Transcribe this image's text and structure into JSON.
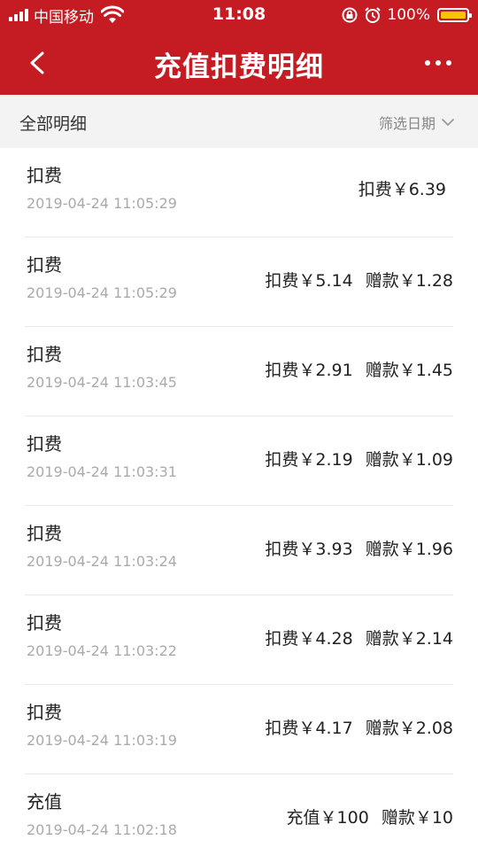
{
  "status_bar": {
    "carrier": "中国移动",
    "time": "11:08",
    "battery": "100%"
  },
  "nav": {
    "title": "充值扣费明细"
  },
  "filter": {
    "label": "全部明细",
    "date_filter": "筛选日期"
  },
  "records": [
    {
      "type": "扣费",
      "date": "2019-04-24 11:05:29",
      "amount": "扣费￥6.39",
      "bonus": ""
    },
    {
      "type": "扣费",
      "date": "2019-04-24 11:05:29",
      "amount": "扣费￥5.14",
      "bonus": "赠款￥1.28"
    },
    {
      "type": "扣费",
      "date": "2019-04-24 11:03:45",
      "amount": "扣费￥2.91",
      "bonus": "赠款￥1.45"
    },
    {
      "type": "扣费",
      "date": "2019-04-24 11:03:31",
      "amount": "扣费￥2.19",
      "bonus": "赠款￥1.09"
    },
    {
      "type": "扣费",
      "date": "2019-04-24 11:03:24",
      "amount": "扣费￥3.93",
      "bonus": "赠款￥1.96"
    },
    {
      "type": "扣费",
      "date": "2019-04-24 11:03:22",
      "amount": "扣费￥4.28",
      "bonus": "赠款￥2.14"
    },
    {
      "type": "扣费",
      "date": "2019-04-24 11:03:19",
      "amount": "扣费￥4.17",
      "bonus": "赠款￥2.08"
    },
    {
      "type": "充值",
      "date": "2019-04-24 11:02:18",
      "amount": "充值￥100",
      "bonus": "赠款￥10"
    }
  ],
  "colors": {
    "header_red": "#c51c24",
    "battery_yellow": "#f7c600"
  },
  "icons": [
    "signal-icon",
    "wifi-icon",
    "rotation-lock-icon",
    "alarm-icon",
    "battery-icon",
    "back-icon",
    "more-icon",
    "chevron-down-icon"
  ]
}
